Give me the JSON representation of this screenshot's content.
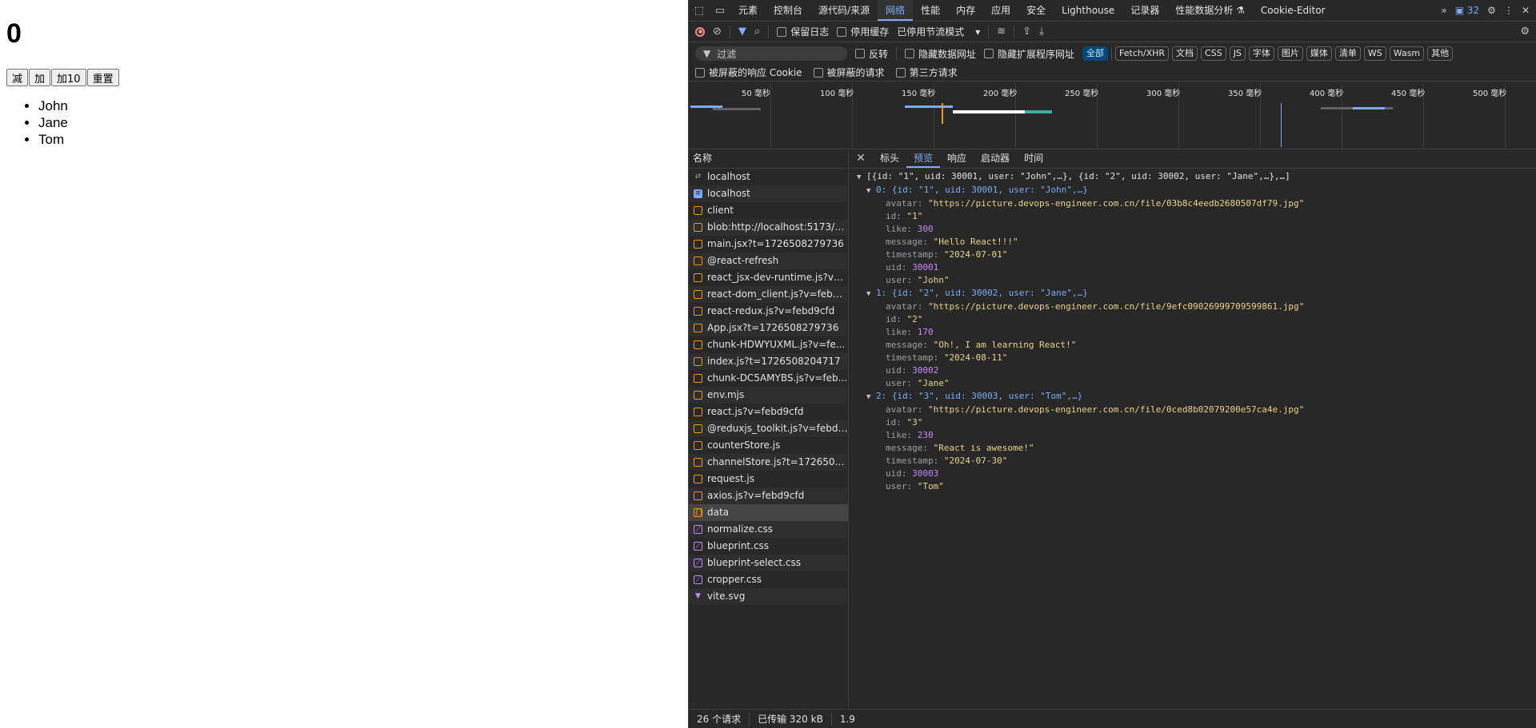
{
  "app": {
    "counter": "0",
    "buttons": [
      "减",
      "加",
      "加10",
      "重置"
    ],
    "names": [
      "John",
      "Jane",
      "Tom"
    ]
  },
  "devtools": {
    "tabs": [
      "元素",
      "控制台",
      "源代码/来源",
      "网络",
      "性能",
      "内存",
      "应用",
      "安全",
      "Lighthouse",
      "记录器",
      "性能数据分析 ⚗",
      "Cookie-Editor"
    ],
    "active_tab": "网络",
    "badge_count": "32",
    "toolbar": {
      "preserve_log": "保留日志",
      "disable_cache": "停用缓存",
      "throttle": "已停用节流模式"
    },
    "filter": {
      "placeholder": "过滤",
      "invert": "反转",
      "hide_data_urls": "隐藏数据网址",
      "hide_ext_urls": "隐藏扩展程序网址",
      "types": [
        "全部",
        "Fetch/XHR",
        "文档",
        "CSS",
        "JS",
        "字体",
        "图片",
        "媒体",
        "清单",
        "WS",
        "Wasm",
        "其他"
      ],
      "blocked_cookies": "被屏蔽的响应 Cookie",
      "blocked_requests": "被屏蔽的请求",
      "third_party": "第三方请求"
    },
    "timeline": {
      "labels": [
        "50 毫秒",
        "100 毫秒",
        "150 毫秒",
        "200 毫秒",
        "250 毫秒",
        "300 毫秒",
        "350 毫秒",
        "400 毫秒",
        "450 毫秒",
        "500 毫秒"
      ]
    },
    "name_header": "名称",
    "requests": [
      {
        "name": "localhost",
        "type": "redir"
      },
      {
        "name": "localhost",
        "type": "doc"
      },
      {
        "name": "client",
        "type": "js"
      },
      {
        "name": "blob:http://localhost:5173/d...",
        "type": "js"
      },
      {
        "name": "main.jsx?t=1726508279736",
        "type": "js"
      },
      {
        "name": "@react-refresh",
        "type": "js"
      },
      {
        "name": "react_jsx-dev-runtime.js?v=f...",
        "type": "js"
      },
      {
        "name": "react-dom_client.js?v=febd9...",
        "type": "js"
      },
      {
        "name": "react-redux.js?v=febd9cfd",
        "type": "js"
      },
      {
        "name": "App.jsx?t=1726508279736",
        "type": "js"
      },
      {
        "name": "chunk-HDWYUXML.js?v=fe...",
        "type": "js"
      },
      {
        "name": "index.js?t=1726508204717",
        "type": "js"
      },
      {
        "name": "chunk-DC5AMYBS.js?v=feb...",
        "type": "js"
      },
      {
        "name": "env.mjs",
        "type": "js"
      },
      {
        "name": "react.js?v=febd9cfd",
        "type": "js"
      },
      {
        "name": "@reduxjs_toolkit.js?v=febd9...",
        "type": "js"
      },
      {
        "name": "counterStore.js",
        "type": "js"
      },
      {
        "name": "channelStore.js?t=17265082...",
        "type": "js"
      },
      {
        "name": "request.js",
        "type": "js"
      },
      {
        "name": "axios.js?v=febd9cfd",
        "type": "js"
      },
      {
        "name": "data",
        "type": "xhr"
      },
      {
        "name": "normalize.css",
        "type": "css"
      },
      {
        "name": "blueprint.css",
        "type": "css"
      },
      {
        "name": "blueprint-select.css",
        "type": "css"
      },
      {
        "name": "cropper.css",
        "type": "css"
      },
      {
        "name": "vite.svg",
        "type": "img"
      }
    ],
    "detail_tabs": [
      "标头",
      "预览",
      "响应",
      "启动器",
      "时间"
    ],
    "active_detail_tab": "预览",
    "preview": {
      "summary": "[{id: \"1\", uid: 30001, user: \"John\",…}, {id: \"2\", uid: 30002, user: \"Jane\",…},…]",
      "items": [
        {
          "header": "0: {id: \"1\", uid: 30001, user: \"John\",…}",
          "avatar": "\"https://picture.devops-engineer.com.cn/file/03b8c4eedb2680507df79.jpg\"",
          "id": "\"1\"",
          "like": "300",
          "message": "\"Hello React!!!\"",
          "timestamp": "\"2024-07-01\"",
          "uid": "30001",
          "user": "\"John\""
        },
        {
          "header": "1: {id: \"2\", uid: 30002, user: \"Jane\",…}",
          "avatar": "\"https://picture.devops-engineer.com.cn/file/9efc09026999709599861.jpg\"",
          "id": "\"2\"",
          "like": "170",
          "message": "\"Oh!, I am learning React!\"",
          "timestamp": "\"2024-08-11\"",
          "uid": "30002",
          "user": "\"Jane\""
        },
        {
          "header": "2: {id: \"3\", uid: 30003, user: \"Tom\",…}",
          "avatar": "\"https://picture.devops-engineer.com.cn/file/0ced8b02079200e57ca4e.jpg\"",
          "id": "\"3\"",
          "like": "230",
          "message": "\"React is awesome!\"",
          "timestamp": "\"2024-07-30\"",
          "uid": "30003",
          "user": "\"Tom\""
        }
      ]
    },
    "status": {
      "requests": "26 个请求",
      "transferred": "已传输 320 kB",
      "extra": "1.9"
    }
  }
}
